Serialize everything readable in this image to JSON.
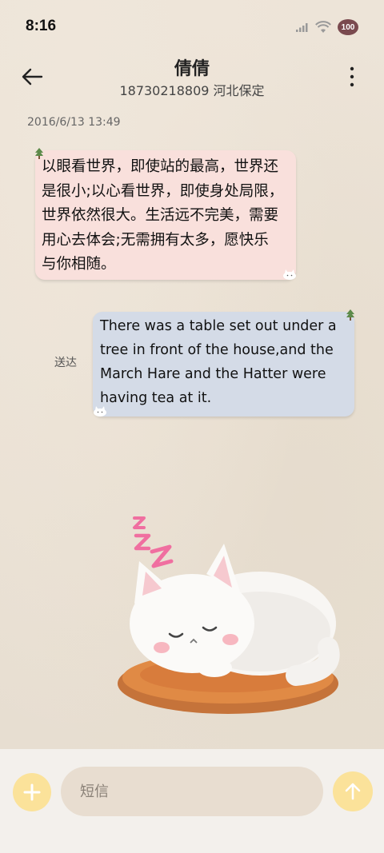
{
  "status_bar": {
    "time": "8:16",
    "battery": "100",
    "icons": [
      "signal-icon",
      "wifi-icon",
      "battery-icon"
    ]
  },
  "header": {
    "contact_name": "倩倩",
    "contact_detail": "18730218809 河北保定",
    "icons": [
      "back-arrow-icon",
      "more-vert-icon"
    ]
  },
  "conversation": {
    "timestamp": "2016/6/13 13:49",
    "messages": [
      {
        "direction": "incoming",
        "lines": [
          "以眼看世界，即使站的最高，世界还",
          "是很小;以心看世界，即使身处局限，",
          "世界依然很大。生活远不完美，需要",
          "用心去体会;无需拥有太多，愿快乐",
          "与你相随。"
        ]
      },
      {
        "direction": "outgoing",
        "lines": [
          "There was a table set out under a",
          "tree in front of the house,and the",
          "March Hare and the Hatter were",
          "having tea at it."
        ],
        "status": "送达"
      }
    ]
  },
  "composer": {
    "placeholder": "短信",
    "icons": [
      "plus-icon",
      "send-arrow-icon"
    ]
  },
  "colors": {
    "incoming_bubble": "#f9e0dc",
    "outgoing_bubble": "#d4dbe7",
    "accent_button": "#fbe29a",
    "background": "#ece3d6"
  }
}
